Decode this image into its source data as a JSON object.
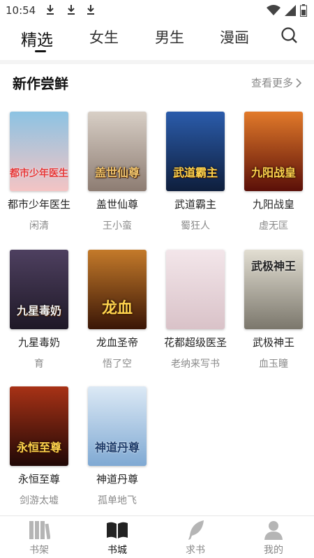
{
  "status_bar": {
    "time": "10:54"
  },
  "tabs": [
    {
      "label": "精选",
      "active": true
    },
    {
      "label": "女生",
      "active": false
    },
    {
      "label": "男生",
      "active": false
    },
    {
      "label": "漫画",
      "active": false
    }
  ],
  "section": {
    "title": "新作尝鲜",
    "more": "查看更多"
  },
  "books": [
    {
      "title": "都市少年医生",
      "author": "闲清",
      "cover_text": "都市少年医生",
      "bg": "#7fb3d6"
    },
    {
      "title": "盖世仙尊",
      "author": "王小蛮",
      "cover_text": "盖世仙尊",
      "bg": "#b8aaa0"
    },
    {
      "title": "武道霸主",
      "author": "蜀狂人",
      "cover_text": "武道霸主",
      "bg": "#1e3c78"
    },
    {
      "title": "九阳战皇",
      "author": "虚无匡",
      "cover_text": "九阳战皇",
      "bg": "#8a1d10"
    },
    {
      "title": "九星毒奶",
      "author": "育",
      "cover_text": "九星毒奶",
      "bg": "#3a2d45"
    },
    {
      "title": "龙血圣帝",
      "author": "悟了空",
      "cover_text": "龙血",
      "bg": "#7a3a10"
    },
    {
      "title": "花都超级医圣",
      "author": "老纳来写书",
      "cover_text": "",
      "bg": "#e9d7dc"
    },
    {
      "title": "武极神王",
      "author": "血玉瞳",
      "cover_text": "武极神王",
      "bg": "#c9c6b8"
    },
    {
      "title": "永恒至尊",
      "author": "剑游太墟",
      "cover_text": "永恒至尊",
      "bg": "#4a1c0c"
    },
    {
      "title": "神道丹尊",
      "author": "孤单地飞",
      "cover_text": "神道丹尊",
      "bg": "#a9c6e2"
    }
  ],
  "bottom_nav": [
    {
      "label": "书架",
      "active": false,
      "icon": "bookshelf-icon"
    },
    {
      "label": "书城",
      "active": true,
      "icon": "open-book-icon"
    },
    {
      "label": "求书",
      "active": false,
      "icon": "feather-icon"
    },
    {
      "label": "我的",
      "active": false,
      "icon": "user-icon"
    }
  ],
  "colors": {
    "active": "#111111",
    "inactive": "#888888",
    "author": "#8a8a8a"
  }
}
